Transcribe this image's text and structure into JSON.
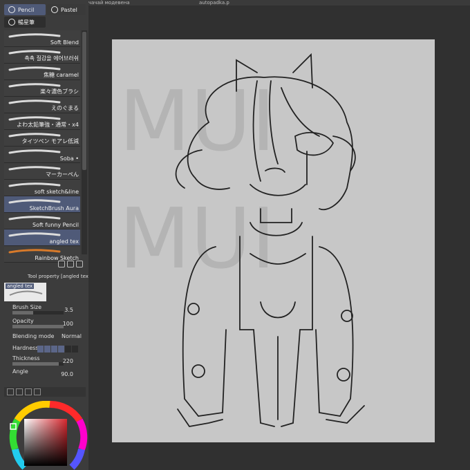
{
  "document_tabs": [
    "чачай модевена",
    "autopadka.p"
  ],
  "subtool_tabs": {
    "pencil_label": "Pencil",
    "pastel_label": "Pastel",
    "third_label": "暢星筆"
  },
  "brushes": [
    {
      "label": "Soft Blend",
      "selected": false
    },
    {
      "label": "촉촉 질감을 에어브러쉬",
      "selected": false
    },
    {
      "label": "焦糖 caramel",
      "selected": false
    },
    {
      "label": "楽々濃色ブラシ",
      "selected": false
    },
    {
      "label": "えのぐまる",
      "selected": false
    },
    {
      "label": "よわ太鉛筆強・通常・x4",
      "selected": false
    },
    {
      "label": "タイツペン モアレ低減",
      "selected": false
    },
    {
      "label": "Soba •",
      "selected": false
    },
    {
      "label": "マーカーぺん",
      "selected": false
    },
    {
      "label": "soft sketch&line",
      "selected": false
    },
    {
      "label": "SketchBrush Aura",
      "selected": true
    },
    {
      "label": "Soft funny Pencil",
      "selected": false
    },
    {
      "label": "angled tex",
      "selected": true
    },
    {
      "label": "Rainbow Sketch",
      "selected": false
    }
  ],
  "tool_property": {
    "header": "Tool property [angled tex]",
    "preview_label": "angled tex",
    "brush_size_label": "Brush Size",
    "brush_size_value": "3.5",
    "opacity_label": "Opacity",
    "opacity_value": "100",
    "blending_mode_label": "Blending mode",
    "blending_mode_value": "Normal",
    "hardness_label": "Hardness",
    "thickness_label": "Thickness",
    "thickness_value": "220",
    "angle_label": "Angle",
    "angle_value": "90.0"
  },
  "canvas": {
    "watermark": "MUI MUI",
    "background_color": "#c7c7c7"
  },
  "colors": {
    "selected_brush_bg": "#4f5a78",
    "panel_bg": "#3c3c3c",
    "workspace_bg": "#303030",
    "color_square_hue": "#d8282f"
  }
}
